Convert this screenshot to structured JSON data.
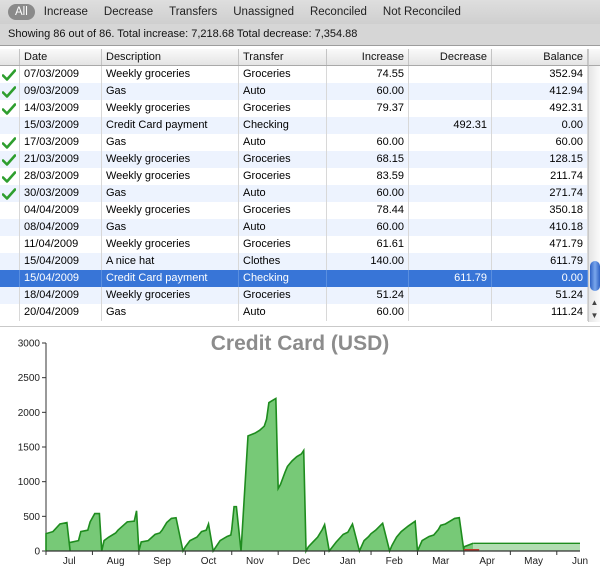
{
  "filters": [
    "All",
    "Increase",
    "Decrease",
    "Transfers",
    "Unassigned",
    "Reconciled",
    "Not Reconciled"
  ],
  "summary": "Showing 86 out of 86. Total increase: 7,218.68 Total decrease: 7,354.88",
  "columns": [
    "Date",
    "Description",
    "Transfer",
    "Increase",
    "Decrease",
    "Balance"
  ],
  "rows": [
    {
      "date": "07/03/2009",
      "description": "Weekly groceries",
      "transfer": "Groceries",
      "increase": "74.55",
      "decrease": "",
      "balance": "352.94",
      "reconciled": true
    },
    {
      "date": "09/03/2009",
      "description": "Gas",
      "transfer": "Auto",
      "increase": "60.00",
      "decrease": "",
      "balance": "412.94",
      "reconciled": true
    },
    {
      "date": "14/03/2009",
      "description": "Weekly groceries",
      "transfer": "Groceries",
      "increase": "79.37",
      "decrease": "",
      "balance": "492.31",
      "reconciled": true
    },
    {
      "date": "15/03/2009",
      "description": "Credit Card payment",
      "transfer": "Checking",
      "increase": "",
      "decrease": "492.31",
      "balance": "0.00",
      "reconciled": false
    },
    {
      "date": "17/03/2009",
      "description": "Gas",
      "transfer": "Auto",
      "increase": "60.00",
      "decrease": "",
      "balance": "60.00",
      "reconciled": true
    },
    {
      "date": "21/03/2009",
      "description": "Weekly groceries",
      "transfer": "Groceries",
      "increase": "68.15",
      "decrease": "",
      "balance": "128.15",
      "reconciled": true
    },
    {
      "date": "28/03/2009",
      "description": "Weekly groceries",
      "transfer": "Groceries",
      "increase": "83.59",
      "decrease": "",
      "balance": "211.74",
      "reconciled": true
    },
    {
      "date": "30/03/2009",
      "description": "Gas",
      "transfer": "Auto",
      "increase": "60.00",
      "decrease": "",
      "balance": "271.74",
      "reconciled": true
    },
    {
      "date": "04/04/2009",
      "description": "Weekly groceries",
      "transfer": "Groceries",
      "increase": "78.44",
      "decrease": "",
      "balance": "350.18",
      "reconciled": false
    },
    {
      "date": "08/04/2009",
      "description": "Gas",
      "transfer": "Auto",
      "increase": "60.00",
      "decrease": "",
      "balance": "410.18",
      "reconciled": false
    },
    {
      "date": "11/04/2009",
      "description": "Weekly groceries",
      "transfer": "Groceries",
      "increase": "61.61",
      "decrease": "",
      "balance": "471.79",
      "reconciled": false
    },
    {
      "date": "15/04/2009",
      "description": "A nice hat",
      "transfer": "Clothes",
      "increase": "140.00",
      "decrease": "",
      "balance": "611.79",
      "reconciled": false
    },
    {
      "date": "15/04/2009",
      "description": "Credit Card payment",
      "transfer": "Checking",
      "increase": "",
      "decrease": "611.79",
      "balance": "0.00",
      "reconciled": false,
      "selected": true
    },
    {
      "date": "18/04/2009",
      "description": "Weekly groceries",
      "transfer": "Groceries",
      "increase": "51.24",
      "decrease": "",
      "balance": "51.24",
      "reconciled": false
    },
    {
      "date": "20/04/2009",
      "description": "Gas",
      "transfer": "Auto",
      "increase": "60.00",
      "decrease": "",
      "balance": "111.24",
      "reconciled": false
    }
  ],
  "colors": {
    "selection": "#3875d7",
    "area_fill": "#5fbf5f",
    "area_line": "#1e8c1e",
    "title": "#8c8c8c",
    "forecast_line": "#c0392b"
  },
  "chart_data": {
    "type": "area",
    "title": "Credit Card (USD)",
    "ylim": [
      0,
      3000
    ],
    "yticks": [
      "0",
      "500",
      "1000",
      "1500",
      "2000",
      "2500",
      "3000"
    ],
    "xticks": [
      "Jul",
      "Aug",
      "Sep",
      "Oct",
      "Nov",
      "Dec",
      "Jan",
      "Feb",
      "Mar",
      "Apr",
      "May",
      "Jun"
    ],
    "grid": false,
    "series": [
      {
        "x": [
          0,
          0.0,
          0.15,
          0.3,
          0.45,
          0.52,
          0.5,
          0.7,
          0.75,
          0.9,
          0.95,
          1.05,
          1.15,
          1.2,
          1.25,
          1.35,
          1.5,
          1.55,
          1.7,
          1.75,
          1.9,
          1.95,
          2.0,
          2.05,
          2.2,
          2.35,
          2.45,
          2.5,
          2.6,
          2.7,
          2.8,
          2.95,
          3.0,
          3.1,
          3.25,
          3.35,
          3.45,
          3.5,
          3.6,
          3.75,
          3.9,
          3.98,
          4.0,
          4.05,
          4.1,
          4.2,
          4.35,
          4.5,
          4.6,
          4.7,
          4.75,
          4.8,
          4.9,
          4.95,
          5.0,
          5.05,
          5.15,
          5.2,
          5.3,
          5.4,
          5.5,
          5.55,
          5.6,
          5.65,
          5.75,
          5.85,
          5.95,
          6.0,
          6.1,
          6.25,
          6.4,
          6.5,
          6.6,
          6.75,
          6.85,
          6.95,
          7.0,
          7.1,
          7.25,
          7.4,
          7.45,
          7.5,
          7.55,
          7.65,
          7.8,
          7.95,
          8.0,
          8.1,
          8.25,
          8.35,
          8.45,
          8.5,
          8.6,
          8.7,
          8.8,
          8.9,
          9.0,
          9.0,
          9.2
        ],
        "y": [
          0,
          250,
          280,
          390,
          410,
          0,
          120,
          150,
          280,
          300,
          420,
          540,
          540,
          0,
          150,
          200,
          260,
          300,
          390,
          420,
          430,
          580,
          0,
          130,
          150,
          240,
          260,
          300,
          410,
          470,
          480,
          0,
          60,
          150,
          200,
          280,
          300,
          390,
          0,
          150,
          210,
          230,
          310,
          640,
          640,
          0,
          1660,
          1700,
          1740,
          1800,
          1900,
          2140,
          2180,
          2200,
          900,
          960,
          1140,
          1220,
          1300,
          1360,
          1400,
          1450,
          0,
          60,
          130,
          200,
          310,
          380,
          0,
          130,
          240,
          270,
          390,
          0,
          150,
          210,
          250,
          300,
          400,
          0,
          80,
          140,
          200,
          280,
          360,
          430,
          0,
          150,
          210,
          230,
          310,
          370,
          390,
          430,
          470,
          480,
          0,
          60,
          111
        ]
      }
    ],
    "forecast_y": 111
  }
}
